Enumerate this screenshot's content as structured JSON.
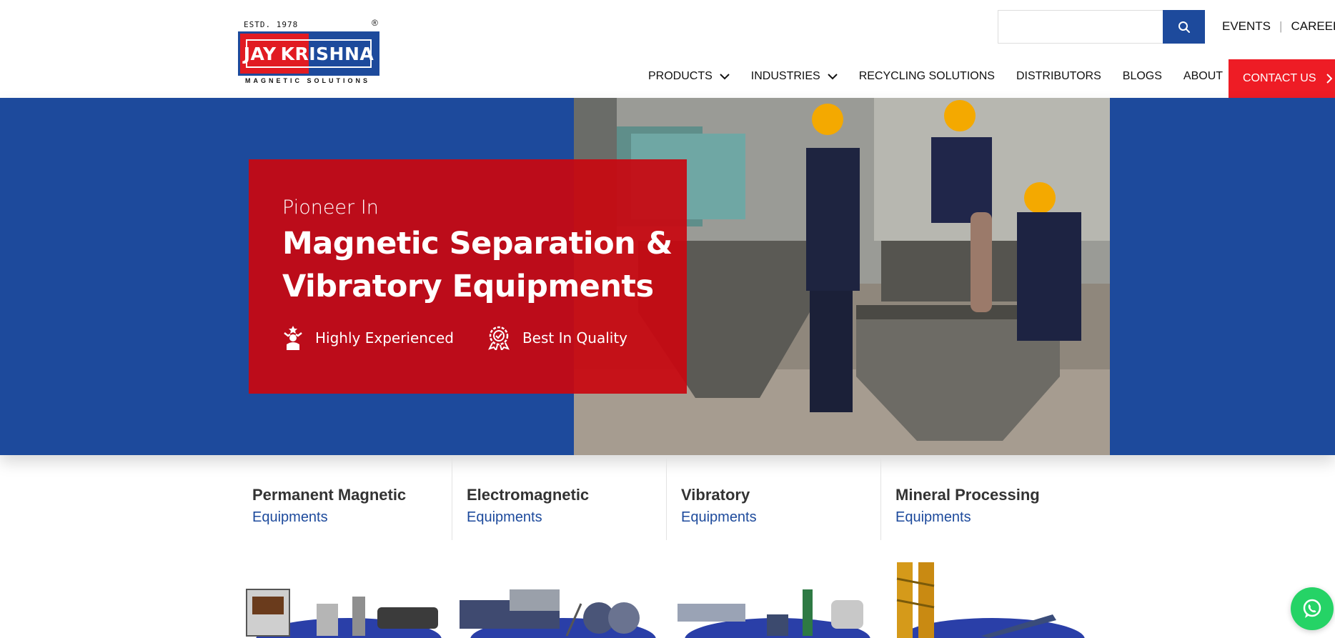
{
  "logo": {
    "estd": "ESTD. 1978",
    "registered": "®",
    "word1": "JAY",
    "word2": "KRISHNA",
    "tagline": "MAGNETIC SOLUTIONS"
  },
  "header": {
    "search_placeholder": "",
    "top_links": [
      "EVENTS",
      "CAREER"
    ],
    "nav": [
      {
        "label": "PRODUCTS",
        "dropdown": true
      },
      {
        "label": "INDUSTRIES",
        "dropdown": true
      },
      {
        "label": "RECYCLING SOLUTIONS",
        "dropdown": false
      },
      {
        "label": "DISTRIBUTORS",
        "dropdown": false
      },
      {
        "label": "BLOGS",
        "dropdown": false
      },
      {
        "label": "ABOUT",
        "dropdown": false
      }
    ],
    "contact_label": "CONTACT US"
  },
  "hero": {
    "pre_title": "Pioneer In",
    "title_line1": "Magnetic Separation &",
    "title_line2": "Vibratory Equipments",
    "features": [
      "Highly Experienced",
      "Best In Quality"
    ]
  },
  "categories": [
    {
      "title": "Permanent Magnetic",
      "subtitle": "Equipments"
    },
    {
      "title": "Electromagnetic",
      "subtitle": "Equipments"
    },
    {
      "title": "Vibratory",
      "subtitle": "Equipments"
    },
    {
      "title": "Mineral Processing",
      "subtitle": "Equipments"
    }
  ],
  "colors": {
    "brand_blue": "#1d4a9c",
    "brand_red": "#ee1c25",
    "whatsapp_green": "#25d366"
  }
}
